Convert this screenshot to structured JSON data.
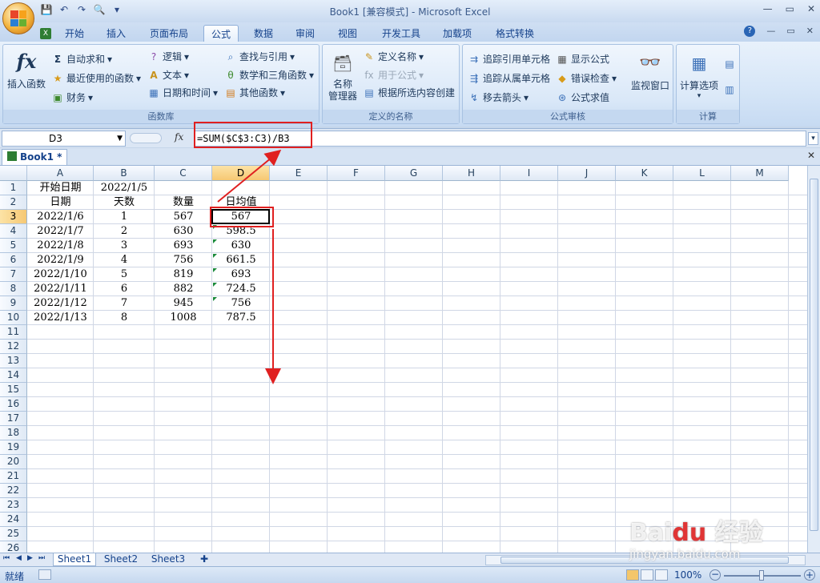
{
  "window": {
    "title": "Book1  [兼容模式] - Microsoft Excel",
    "min": "—",
    "max": "▭",
    "close": "✕"
  },
  "qat": {
    "save": "💾",
    "undo": "↶",
    "redo": "↷",
    "print_preview": "🔍",
    "customize": "▾"
  },
  "tabs": [
    {
      "label": "开始"
    },
    {
      "label": "插入"
    },
    {
      "label": "页面布局"
    },
    {
      "label": "公式"
    },
    {
      "label": "数据"
    },
    {
      "label": "审阅"
    },
    {
      "label": "视图"
    },
    {
      "label": "开发工具"
    },
    {
      "label": "加载项"
    },
    {
      "label": "格式转换"
    }
  ],
  "active_tab": "公式",
  "ribbon": {
    "function_library": {
      "label": "函数库",
      "insert_function": "插入函数",
      "autosum": "自动求和",
      "recent": "最近使用的函数",
      "financial": "财务",
      "logical": "逻辑",
      "text": "文本",
      "datetime": "日期和时间",
      "lookup": "查找与引用",
      "math": "数学和三角函数",
      "other": "其他函数"
    },
    "defined_names": {
      "label": "定义的名称",
      "name_manager": "名称\n管理器",
      "define_name": "定义名称",
      "use_in_formula": "用于公式",
      "create_from_selection": "根据所选内容创建"
    },
    "formula_auditing": {
      "label": "公式审核",
      "trace_precedents": "追踪引用单元格",
      "trace_dependents": "追踪从属单元格",
      "remove_arrows": "移去箭头",
      "show_formulas": "显示公式",
      "error_checking": "错误检查",
      "evaluate_formula": "公式求值",
      "watch_window": "监视窗口"
    },
    "calculation": {
      "label": "计算",
      "calc_options": "计算选项"
    }
  },
  "formula_bar": {
    "name_box": "D3",
    "fx": "fx",
    "formula": "=SUM($C$3:C3)/B3"
  },
  "workbook_tab": "Book1 *",
  "columns": [
    "A",
    "B",
    "C",
    "D",
    "E",
    "F",
    "G",
    "H",
    "I",
    "J",
    "K",
    "L",
    "M"
  ],
  "selected_column": "D",
  "selected_row": 3,
  "rows": [
    "1",
    "2",
    "3",
    "4",
    "5",
    "6",
    "7",
    "8",
    "9",
    "10",
    "11",
    "12",
    "13",
    "14",
    "15",
    "16",
    "17",
    "18",
    "19",
    "20",
    "21",
    "22",
    "23",
    "24",
    "25",
    "26"
  ],
  "cells": {
    "A1": "开始日期",
    "B1": "2022/1/5",
    "A2": "日期",
    "B2": "天数",
    "C2": "数量",
    "D2": "日均值",
    "A3": "2022/1/6",
    "B3": "1",
    "C3": "567",
    "D3": "567",
    "A4": "2022/1/7",
    "B4": "2",
    "C4": "630",
    "D4": "598.5",
    "A5": "2022/1/8",
    "B5": "3",
    "C5": "693",
    "D5": "630",
    "A6": "2022/1/9",
    "B6": "4",
    "C6": "756",
    "D6": "661.5",
    "A7": "2022/1/10",
    "B7": "5",
    "C7": "819",
    "D7": "693",
    "A8": "2022/1/11",
    "B8": "6",
    "C8": "882",
    "D8": "724.5",
    "A9": "2022/1/12",
    "B9": "7",
    "C9": "945",
    "D9": "756",
    "A10": "2022/1/13",
    "B10": "8",
    "C10": "1008",
    "D10": "787.5"
  },
  "sheets": [
    {
      "label": "Sheet1"
    },
    {
      "label": "Sheet2"
    },
    {
      "label": "Sheet3"
    }
  ],
  "active_sheet": "Sheet1",
  "status": {
    "ready": "就绪",
    "zoom": "100%"
  },
  "watermark": {
    "brand": "Bai du 经验",
    "url": "jingyan.baidu.com"
  },
  "colors": {
    "annotation": "#e02020",
    "ribbon_bg": "#dbe8f8",
    "selected_header": "#f6c873"
  }
}
